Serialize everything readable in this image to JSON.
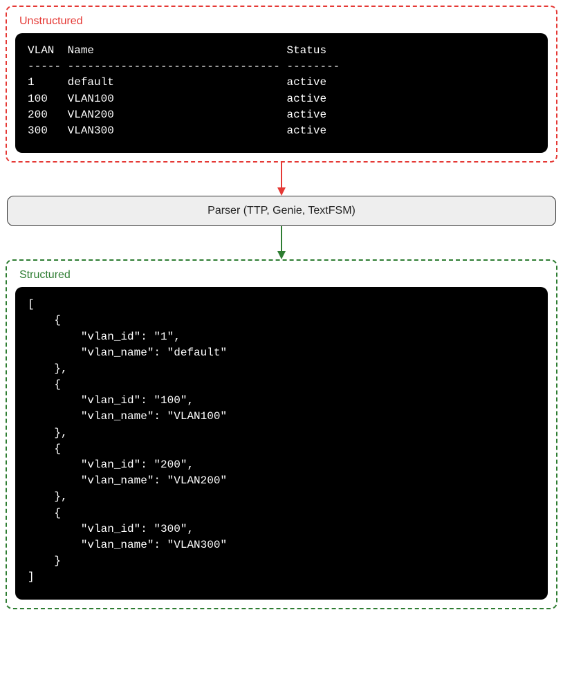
{
  "unstructured": {
    "label": "Unstructured",
    "headers": {
      "vlan": "VLAN",
      "name": "Name",
      "status": "Status"
    },
    "rows": [
      {
        "vlan": "1",
        "name": "default",
        "status": "active"
      },
      {
        "vlan": "100",
        "name": "VLAN100",
        "status": "active"
      },
      {
        "vlan": "200",
        "name": "VLAN200",
        "status": "active"
      },
      {
        "vlan": "300",
        "name": "VLAN300",
        "status": "active"
      }
    ]
  },
  "parser": {
    "label": "Parser (TTP, Genie, TextFSM)"
  },
  "structured": {
    "label": "Structured",
    "records": [
      {
        "vlan_id": "1",
        "vlan_name": "default"
      },
      {
        "vlan_id": "100",
        "vlan_name": "VLAN100"
      },
      {
        "vlan_id": "200",
        "vlan_name": "VLAN200"
      },
      {
        "vlan_id": "300",
        "vlan_name": "VLAN300"
      }
    ]
  },
  "colors": {
    "unstructured_border": "#e53935",
    "structured_border": "#2e7d32",
    "arrow_down_red": "#e53935",
    "arrow_down_green": "#2e7d32"
  }
}
